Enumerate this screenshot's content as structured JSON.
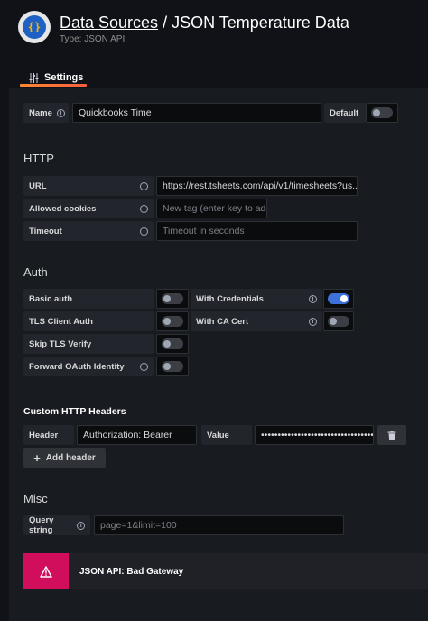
{
  "header": {
    "breadcrumb_link": "Data Sources",
    "separator": " / ",
    "title": "JSON Temperature Data",
    "subtitle": "Type: JSON API"
  },
  "tabs": [
    {
      "label": "Settings",
      "icon": "sliders-icon"
    }
  ],
  "name_row": {
    "label": "Name",
    "value": "Quickbooks Time",
    "default_label": "Default",
    "default_on": false
  },
  "http": {
    "heading": "HTTP",
    "url_label": "URL",
    "url_value": "https://rest.tsheets.com/api/v1/timesheets?us...",
    "cookies_label": "Allowed cookies",
    "cookies_placeholder": "New tag (enter key to add",
    "timeout_label": "Timeout",
    "timeout_placeholder": "Timeout in seconds"
  },
  "auth": {
    "heading": "Auth",
    "basic_auth": "Basic auth",
    "with_credentials": "With Credentials",
    "tls_client_auth": "TLS Client Auth",
    "with_ca_cert": "With CA Cert",
    "skip_tls": "Skip TLS Verify",
    "forward_oauth": "Forward OAuth Identity",
    "with_credentials_on": true
  },
  "custom_headers": {
    "heading": "Custom HTTP Headers",
    "header_label": "Header",
    "header_value": "Authorization: Bearer",
    "value_label": "Value",
    "value_masked": "••••••••••••••••••••••••••••••••••...",
    "add_label": "Add header"
  },
  "misc": {
    "heading": "Misc",
    "query_label": "Query string",
    "query_value": "page=1&limit=100"
  },
  "alert": {
    "text": "JSON API: Bad Gateway",
    "color": "#d10e5c"
  },
  "colors": {
    "accent": "#3d71d9",
    "tab_underline": "#ff8833"
  }
}
